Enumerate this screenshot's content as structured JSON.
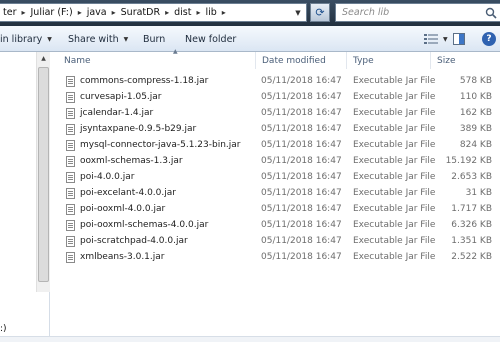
{
  "address": {
    "crumbs": [
      "ter",
      "Juliar (F:)",
      "java",
      "SuratDR",
      "dist",
      "lib"
    ],
    "search_placeholder": "Search lib"
  },
  "toolbar": {
    "include_library": "in library",
    "share_with": "Share with",
    "burn": "Burn",
    "new_folder": "New folder"
  },
  "nav": {
    "bottom_item": ":)"
  },
  "columns": {
    "name": "Name",
    "date": "Date modified",
    "type": "Type",
    "size": "Size"
  },
  "files": [
    {
      "name": "commons-compress-1.18.jar",
      "date": "05/11/2018 16:47",
      "type": "Executable Jar File",
      "size": "578 KB"
    },
    {
      "name": "curvesapi-1.05.jar",
      "date": "05/11/2018 16:47",
      "type": "Executable Jar File",
      "size": "110 KB"
    },
    {
      "name": "jcalendar-1.4.jar",
      "date": "05/11/2018 16:47",
      "type": "Executable Jar File",
      "size": "162 KB"
    },
    {
      "name": "jsyntaxpane-0.9.5-b29.jar",
      "date": "05/11/2018 16:47",
      "type": "Executable Jar File",
      "size": "389 KB"
    },
    {
      "name": "mysql-connector-java-5.1.23-bin.jar",
      "date": "05/11/2018 16:47",
      "type": "Executable Jar File",
      "size": "824 KB"
    },
    {
      "name": "ooxml-schemas-1.3.jar",
      "date": "05/11/2018 16:47",
      "type": "Executable Jar File",
      "size": "15.192 KB"
    },
    {
      "name": "poi-4.0.0.jar",
      "date": "05/11/2018 16:47",
      "type": "Executable Jar File",
      "size": "2.653 KB"
    },
    {
      "name": "poi-excelant-4.0.0.jar",
      "date": "05/11/2018 16:47",
      "type": "Executable Jar File",
      "size": "31 KB"
    },
    {
      "name": "poi-ooxml-4.0.0.jar",
      "date": "05/11/2018 16:47",
      "type": "Executable Jar File",
      "size": "1.717 KB"
    },
    {
      "name": "poi-ooxml-schemas-4.0.0.jar",
      "date": "05/11/2018 16:47",
      "type": "Executable Jar File",
      "size": "6.326 KB"
    },
    {
      "name": "poi-scratchpad-4.0.0.jar",
      "date": "05/11/2018 16:47",
      "type": "Executable Jar File",
      "size": "1.351 KB"
    },
    {
      "name": "xmlbeans-3.0.1.jar",
      "date": "05/11/2018 16:47",
      "type": "Executable Jar File",
      "size": "2.522 KB"
    }
  ]
}
